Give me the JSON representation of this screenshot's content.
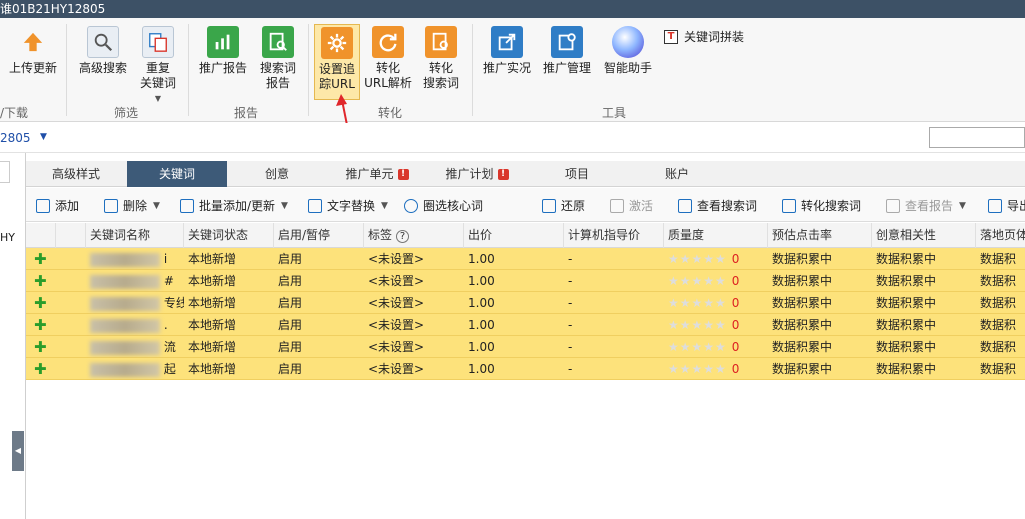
{
  "window": {
    "title": "谁01B21HY12805"
  },
  "ribbon": {
    "upload": "上传更新",
    "adv_search": "高级搜索",
    "dup_kw": [
      "重复",
      "关键词"
    ],
    "promo_report": "推广报告",
    "search_report": [
      "搜索词",
      "报告"
    ],
    "track_url": [
      "设置追",
      "踪URL"
    ],
    "convert_url": [
      "转化",
      "URL解析"
    ],
    "convert_search": [
      "转化",
      "搜索词"
    ],
    "promo_live": "推广实况",
    "promo_manage": "推广管理",
    "smart_helper": "智能助手",
    "kw_combine": "关键词拼装",
    "groups": {
      "download": "/下载",
      "filter": "筛选",
      "report": "报告",
      "convert": "转化",
      "tools": "工具"
    }
  },
  "address": {
    "account_id": "2805"
  },
  "left": {
    "label": "HY"
  },
  "tabs": [
    {
      "label": "高级样式"
    },
    {
      "label": "关键词"
    },
    {
      "label": "创意"
    },
    {
      "label": "推广单元"
    },
    {
      "label": "推广计划"
    },
    {
      "label": "项目"
    },
    {
      "label": "账户"
    }
  ],
  "toolbar": {
    "add": "添加",
    "delete": "删除",
    "batch": "批量添加/更新",
    "replace": "文字替换",
    "core": "圈选核心词",
    "restore": "还原",
    "activate": "激活",
    "view_search": "查看搜索词",
    "convert_search": "转化搜索词",
    "view_report": "查看报告",
    "export": "导出"
  },
  "table": {
    "headers": [
      "关键词名称",
      "关键词状态",
      "启用/暂停",
      "标签",
      "出价",
      "计算机指导价",
      "质量度",
      "预估点击率",
      "创意相关性",
      "落地页体"
    ],
    "rows": [
      {
        "name_visible": "i",
        "status": "本地新增",
        "enabled": "启用",
        "tag": "<未设置>",
        "bid": "1.00",
        "guide": "-",
        "quality": "0",
        "ctr": "数据积累中",
        "rel": "数据积累中",
        "landing": "数据积"
      },
      {
        "name_visible": "#",
        "status": "本地新增",
        "enabled": "启用",
        "tag": "<未设置>",
        "bid": "1.00",
        "guide": "-",
        "quality": "0",
        "ctr": "数据积累中",
        "rel": "数据积累中",
        "landing": "数据积"
      },
      {
        "name_visible": "专线",
        "status": "本地新增",
        "enabled": "启用",
        "tag": "<未设置>",
        "bid": "1.00",
        "guide": "-",
        "quality": "0",
        "ctr": "数据积累中",
        "rel": "数据积累中",
        "landing": "数据积"
      },
      {
        "name_visible": ".",
        "status": "本地新增",
        "enabled": "启用",
        "tag": "<未设置>",
        "bid": "1.00",
        "guide": "-",
        "quality": "0",
        "ctr": "数据积累中",
        "rel": "数据积累中",
        "landing": "数据积"
      },
      {
        "name_visible": "流",
        "status": "本地新增",
        "enabled": "启用",
        "tag": "<未设置>",
        "bid": "1.00",
        "guide": "-",
        "quality": "0",
        "ctr": "数据积累中",
        "rel": "数据积累中",
        "landing": "数据积"
      },
      {
        "name_visible": "起",
        "status": "本地新增",
        "enabled": "启用",
        "tag": "<未设置>",
        "bid": "1.00",
        "guide": "-",
        "quality": "0",
        "ctr": "数据积累中",
        "rel": "数据积累中",
        "landing": "数据积"
      }
    ]
  },
  "colors": {
    "accent": "#3d5a78",
    "row_highlight": "#fde27b",
    "icon_green": "#3aa64a",
    "icon_orange": "#f0932b",
    "icon_blue": "#2f7dc6"
  }
}
